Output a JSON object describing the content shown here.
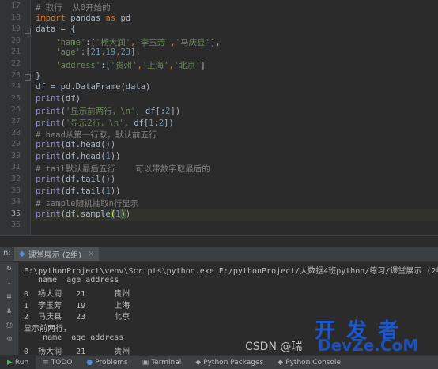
{
  "editor": {
    "lines": [
      {
        "num": "17",
        "parts": [
          {
            "t": "# 取行  从0开始的",
            "c": "cm"
          }
        ]
      },
      {
        "num": "18",
        "parts": [
          {
            "t": "import ",
            "c": "kw"
          },
          {
            "t": "pandas ",
            "c": ""
          },
          {
            "t": "as ",
            "c": "kw"
          },
          {
            "t": "pd",
            "c": ""
          }
        ]
      },
      {
        "num": "19",
        "parts": [
          {
            "t": "data = {",
            "c": ""
          }
        ]
      },
      {
        "num": "20",
        "parts": [
          {
            "t": "    ",
            "c": ""
          },
          {
            "t": "'name'",
            "c": "str"
          },
          {
            "t": ":[",
            "c": ""
          },
          {
            "t": "'杨大润'",
            "c": "str"
          },
          {
            "t": ",",
            "c": "kw"
          },
          {
            "t": "'李玉芳'",
            "c": "str"
          },
          {
            "t": ",",
            "c": "kw"
          },
          {
            "t": "'马庆县'",
            "c": "str"
          },
          {
            "t": "],",
            "c": ""
          }
        ]
      },
      {
        "num": "21",
        "parts": [
          {
            "t": "    ",
            "c": ""
          },
          {
            "t": "'age'",
            "c": "str"
          },
          {
            "t": ":[",
            "c": ""
          },
          {
            "t": "21",
            "c": "num"
          },
          {
            "t": ",",
            "c": "kw"
          },
          {
            "t": "19",
            "c": "num"
          },
          {
            "t": ",",
            "c": "kw"
          },
          {
            "t": "23",
            "c": "num"
          },
          {
            "t": "],",
            "c": ""
          }
        ]
      },
      {
        "num": "22",
        "parts": [
          {
            "t": "    ",
            "c": ""
          },
          {
            "t": "'address'",
            "c": "str"
          },
          {
            "t": ":[",
            "c": ""
          },
          {
            "t": "'贵州'",
            "c": "str"
          },
          {
            "t": ",",
            "c": "kw"
          },
          {
            "t": "'上海'",
            "c": "str"
          },
          {
            "t": ",",
            "c": "kw"
          },
          {
            "t": "'北京'",
            "c": "str"
          },
          {
            "t": "]",
            "c": ""
          }
        ]
      },
      {
        "num": "23",
        "parts": [
          {
            "t": "}",
            "c": ""
          }
        ]
      },
      {
        "num": "24",
        "parts": [
          {
            "t": "df = pd.DataFrame(data)",
            "c": ""
          }
        ]
      },
      {
        "num": "25",
        "parts": [
          {
            "t": "print",
            "c": "fn"
          },
          {
            "t": "(df)",
            "c": ""
          }
        ]
      },
      {
        "num": "26",
        "parts": [
          {
            "t": "print",
            "c": "fn"
          },
          {
            "t": "(",
            "c": ""
          },
          {
            "t": "'显示前两行，\\n'",
            "c": "str"
          },
          {
            "t": ", df[:",
            "c": ""
          },
          {
            "t": "2",
            "c": "num"
          },
          {
            "t": "])",
            "c": ""
          }
        ]
      },
      {
        "num": "27",
        "parts": [
          {
            "t": "print",
            "c": "fn"
          },
          {
            "t": "(",
            "c": ""
          },
          {
            "t": "'显示2行，\\n'",
            "c": "str"
          },
          {
            "t": ", df[",
            "c": ""
          },
          {
            "t": "1",
            "c": "num"
          },
          {
            "t": ":",
            "c": ""
          },
          {
            "t": "2",
            "c": "num"
          },
          {
            "t": "])",
            "c": ""
          }
        ]
      },
      {
        "num": "28",
        "parts": [
          {
            "t": "# head从第一行取，默认前五行",
            "c": "cm"
          }
        ]
      },
      {
        "num": "29",
        "parts": [
          {
            "t": "print",
            "c": "fn"
          },
          {
            "t": "(df.head())",
            "c": ""
          }
        ]
      },
      {
        "num": "30",
        "parts": [
          {
            "t": "print",
            "c": "fn"
          },
          {
            "t": "(df.head(",
            "c": ""
          },
          {
            "t": "1",
            "c": "num"
          },
          {
            "t": "))",
            "c": ""
          }
        ]
      },
      {
        "num": "31",
        "parts": [
          {
            "t": "# tail默认最后五行    可以带数字取最后的",
            "c": "cm"
          }
        ]
      },
      {
        "num": "32",
        "parts": [
          {
            "t": "print",
            "c": "fn"
          },
          {
            "t": "(df.tail())",
            "c": ""
          }
        ]
      },
      {
        "num": "33",
        "parts": [
          {
            "t": "print",
            "c": "fn"
          },
          {
            "t": "(df.tail(",
            "c": ""
          },
          {
            "t": "1",
            "c": "num"
          },
          {
            "t": "))",
            "c": ""
          }
        ]
      },
      {
        "num": "34",
        "parts": [
          {
            "t": "# sample随机抽取n行显示",
            "c": "cm"
          }
        ]
      },
      {
        "num": "35",
        "parts": [
          {
            "t": "print",
            "c": "fn"
          },
          {
            "t": "(df.sample",
            "c": ""
          },
          {
            "t": "(",
            "c": "br"
          },
          {
            "t": "1",
            "c": "num"
          },
          {
            "t": ")",
            "c": "br"
          },
          {
            "t": ")",
            "c": ""
          }
        ]
      },
      {
        "num": "36",
        "parts": []
      }
    ]
  },
  "run_panel": {
    "label": "n:",
    "tab_label": "课堂展示 (2组)",
    "console_lines": [
      "E:\\pythonProject\\venv\\Scripts\\python.exe E:/pythonProject/大数据4班python/练习/课堂展示 (2组) .py",
      "   name  age address",
      "0  杨大润   21      贵州",
      "1  李玉芳   19      上海",
      "2  马庆县   23      北京",
      "显示前两行，",
      "    name  age address",
      "0  杨大润   21      贵州"
    ]
  },
  "bottom_bar": {
    "items": [
      {
        "icon": "▶",
        "label": "Run"
      },
      {
        "icon": "≡",
        "label": "TODO"
      },
      {
        "icon": "●",
        "label": "Problems"
      },
      {
        "icon": "▣",
        "label": "Terminal"
      },
      {
        "icon": "◆",
        "label": "Python Packages"
      },
      {
        "icon": "◆",
        "label": "Python Console"
      }
    ]
  },
  "watermark": {
    "big": "开发者",
    "small": "CSDN @瑞",
    "dev": "DevZe.CoM"
  }
}
